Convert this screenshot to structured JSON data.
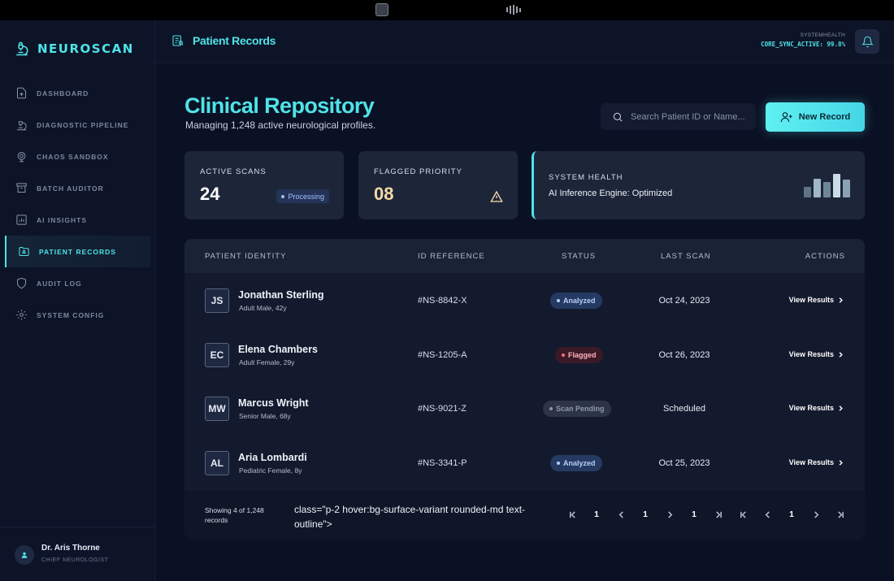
{
  "sidebar": {
    "brand": "NEUROSCAN",
    "items": [
      {
        "label": "DASHBOARD",
        "icon": "dashboard-icon",
        "active": false
      },
      {
        "label": "DIAGNOSTIC PIPELINE",
        "icon": "microscope-icon",
        "active": false
      },
      {
        "label": "CHAOS SANDBOX",
        "icon": "sandbox-icon",
        "active": false
      },
      {
        "label": "BATCH AUDITOR",
        "icon": "archive-icon",
        "active": false
      },
      {
        "label": "AI INSIGHTS",
        "icon": "chart-icon",
        "active": false
      },
      {
        "label": "PATIENT RECORDS",
        "icon": "folder-icon",
        "active": true
      },
      {
        "label": "AUDIT LOG",
        "icon": "shield-icon",
        "active": false
      },
      {
        "label": "SYSTEM CONFIG",
        "icon": "gear-icon",
        "active": false
      }
    ],
    "user": {
      "name": "Dr. Aris Thorne",
      "role": "CHIEF NEUROLOGIST"
    }
  },
  "header": {
    "title": "Patient Records",
    "system_health_label": "SYSTEMHEALTH",
    "system_health_value": "CORE_SYNC_ACTIVE: 99.8%"
  },
  "main": {
    "title": "Clinical Repository",
    "subtitle": "Managing 1,248 active neurological profiles.",
    "search_placeholder": "Search Patient ID or Name...",
    "new_record_label": "New Record"
  },
  "stats": {
    "active_scans": {
      "label": "ACTIVE SCANS",
      "value": "24",
      "chip": "Processing"
    },
    "flagged": {
      "label": "FLAGGED PRIORITY",
      "value": "08"
    },
    "system": {
      "label": "SYSTEM HEALTH",
      "engine": "AI Inference Engine: Optimized",
      "bars": [
        0.45,
        0.8,
        0.65,
        1.0,
        0.75
      ]
    }
  },
  "table": {
    "headers": {
      "identity": "PATIENT IDENTITY",
      "id": "ID REFERENCE",
      "status": "STATUS",
      "last_scan": "LAST SCAN",
      "actions": "ACTIONS"
    },
    "rows": [
      {
        "initials": "JS",
        "name": "Jonathan Sterling",
        "meta": "Adult Male, 42y",
        "id": "#NS-8842-X",
        "status": "Analyzed",
        "last_scan": "Oct 24, 2023",
        "action": "View Results"
      },
      {
        "initials": "EC",
        "name": "Elena Chambers",
        "meta": "Adult Female, 29y",
        "id": "#NS-1205-A",
        "status": "Flagged",
        "last_scan": "Oct 26, 2023",
        "action": "View Results"
      },
      {
        "initials": "MW",
        "name": "Marcus Wright",
        "meta": "Senior Male, 68y",
        "id": "#NS-9021-Z",
        "status": "Scan Pending",
        "last_scan": "Scheduled",
        "action": "View Results"
      },
      {
        "initials": "AL",
        "name": "Aria Lombardi",
        "meta": "Pediatric Female, 8y",
        "id": "#NS-3341-P",
        "status": "Analyzed",
        "last_scan": "Oct 25, 2023",
        "action": "View Results"
      }
    ],
    "footer": {
      "showing": "Showing 4 of 1,248 records",
      "leaked_markup": "class=\"p-2 hover:bg-surface-variant rounded-md text-outline\">",
      "page_numbers": [
        "1",
        "1",
        "1",
        "1"
      ]
    }
  },
  "colors": {
    "accent": "#4fe3e8",
    "bg": "#0b1124",
    "flagged": "#ff6c80",
    "analyzed": "#b7cffb"
  }
}
